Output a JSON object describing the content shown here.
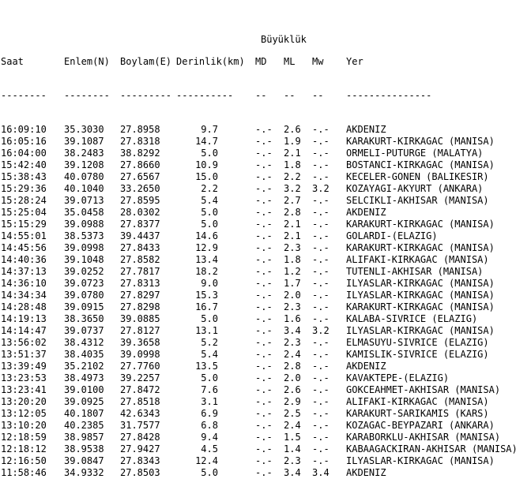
{
  "header": {
    "group_label": "Büyüklük",
    "columns": [
      "Saat",
      "Enlem(N)",
      "Boylam(E)",
      "Derinlik(km)",
      "MD",
      "ML",
      "Mw",
      "Yer"
    ],
    "underlines": [
      "--------",
      "--------",
      "---------",
      "----------",
      "--",
      "--",
      "--",
      "---------------"
    ]
  },
  "rows": [
    [
      "16:09:10",
      "35.3030",
      "27.8958",
      "9.7",
      "-.-",
      "2.6",
      "-.-",
      "AKDENIZ"
    ],
    [
      "16:05:16",
      "39.1087",
      "27.8318",
      "14.7",
      "-.-",
      "1.9",
      "-.-",
      "KARAKURT-KIRKAGAC (MANISA)"
    ],
    [
      "16:04:00",
      "38.2483",
      "38.8292",
      "5.0",
      "-.-",
      "2.1",
      "-.-",
      "ORMELI-PUTURGE (MALATYA)"
    ],
    [
      "15:42:40",
      "39.1208",
      "27.8660",
      "10.9",
      "-.-",
      "1.8",
      "-.-",
      "BOSTANCI-KIRKAGAC (MANISA)"
    ],
    [
      "15:38:43",
      "40.0780",
      "27.6567",
      "15.0",
      "-.-",
      "2.2",
      "-.-",
      "KECELER-GONEN (BALIKESIR)"
    ],
    [
      "15:29:36",
      "40.1040",
      "33.2650",
      "2.2",
      "-.-",
      "3.2",
      "3.2",
      "KOZAYAGI-AKYURT (ANKARA)"
    ],
    [
      "15:28:24",
      "39.0713",
      "27.8595",
      "5.4",
      "-.-",
      "2.7",
      "-.-",
      "SELCIKLI-AKHISAR (MANISA)"
    ],
    [
      "15:25:04",
      "35.0458",
      "28.0302",
      "5.0",
      "-.-",
      "2.8",
      "-.-",
      "AKDENIZ"
    ],
    [
      "15:15:29",
      "39.0988",
      "27.8377",
      "5.0",
      "-.-",
      "2.1",
      "-.-",
      "KARAKURT-KIRKAGAC (MANISA)"
    ],
    [
      "14:55:01",
      "38.5373",
      "39.4437",
      "14.6",
      "-.-",
      "2.1",
      "-.-",
      "GOLARDI-(ELAZIG)"
    ],
    [
      "14:45:56",
      "39.0998",
      "27.8433",
      "12.9",
      "-.-",
      "2.3",
      "-.-",
      "KARAKURT-KIRKAGAC (MANISA)"
    ],
    [
      "14:40:36",
      "39.1048",
      "27.8582",
      "13.4",
      "-.-",
      "1.8",
      "-.-",
      "ALIFAKI-KIRKAGAC (MANISA)"
    ],
    [
      "14:37:13",
      "39.0252",
      "27.7817",
      "18.2",
      "-.-",
      "1.2",
      "-.-",
      "TUTENLI-AKHISAR (MANISA)"
    ],
    [
      "14:36:10",
      "39.0723",
      "27.8313",
      "9.0",
      "-.-",
      "1.7",
      "-.-",
      "ILYASLAR-KIRKAGAC (MANISA)"
    ],
    [
      "14:34:34",
      "39.0780",
      "27.8297",
      "15.3",
      "-.-",
      "2.0",
      "-.-",
      "ILYASLAR-KIRKAGAC (MANISA)"
    ],
    [
      "14:28:48",
      "39.0915",
      "27.8298",
      "16.7",
      "-.-",
      "2.3",
      "-.-",
      "KARAKURT-KIRKAGAC (MANISA)"
    ],
    [
      "14:19:13",
      "38.3650",
      "39.0885",
      "5.0",
      "-.-",
      "1.6",
      "-.-",
      "KALABA-SIVRICE (ELAZIG)"
    ],
    [
      "14:14:47",
      "39.0737",
      "27.8127",
      "13.1",
      "-.-",
      "3.4",
      "3.2",
      "ILYASLAR-KIRKAGAC (MANISA)"
    ],
    [
      "13:56:02",
      "38.4312",
      "39.3658",
      "5.2",
      "-.-",
      "2.3",
      "-.-",
      "ELMASUYU-SIVRICE (ELAZIG)"
    ],
    [
      "13:51:37",
      "38.4035",
      "39.0998",
      "5.4",
      "-.-",
      "2.4",
      "-.-",
      "KAMISLIK-SIVRICE (ELAZIG)"
    ],
    [
      "13:39:49",
      "35.2102",
      "27.7760",
      "13.5",
      "-.-",
      "2.8",
      "-.-",
      "AKDENIZ"
    ],
    [
      "13:23:53",
      "38.4973",
      "39.2257",
      "5.0",
      "-.-",
      "2.0",
      "-.-",
      "KAVAKTEPE-(ELAZIG)"
    ],
    [
      "13:23:41",
      "39.0100",
      "27.8472",
      "7.6",
      "-.-",
      "2.6",
      "-.-",
      "GOKCEAHMET-AKHISAR (MANISA)"
    ],
    [
      "13:20:20",
      "39.0925",
      "27.8518",
      "3.1",
      "-.-",
      "2.9",
      "-.-",
      "ALIFAKI-KIRKAGAC (MANISA)"
    ],
    [
      "13:12:05",
      "40.1807",
      "42.6343",
      "6.9",
      "-.-",
      "2.5",
      "-.-",
      "KARAKURT-SARIKAMIS (KARS)"
    ],
    [
      "13:10:20",
      "40.2385",
      "31.7577",
      "6.8",
      "-.-",
      "2.4",
      "-.-",
      "KOZAGAC-BEYPAZARI (ANKARA)"
    ],
    [
      "12:18:59",
      "38.9857",
      "27.8428",
      "9.4",
      "-.-",
      "1.5",
      "-.-",
      "KARABORKLU-AKHISAR (MANISA)"
    ],
    [
      "12:18:12",
      "38.9538",
      "27.9427",
      "4.5",
      "-.-",
      "1.4",
      "-.-",
      "KABAAGACKIRAN-AKHISAR (MANISA)"
    ],
    [
      "12:16:50",
      "39.0847",
      "27.8343",
      "12.4",
      "-.-",
      "2.3",
      "-.-",
      "ILYASLAR-KIRKAGAC (MANISA)"
    ],
    [
      "11:58:46",
      "34.9332",
      "27.8503",
      "5.0",
      "-.-",
      "3.4",
      "3.4",
      "AKDENIZ"
    ]
  ]
}
